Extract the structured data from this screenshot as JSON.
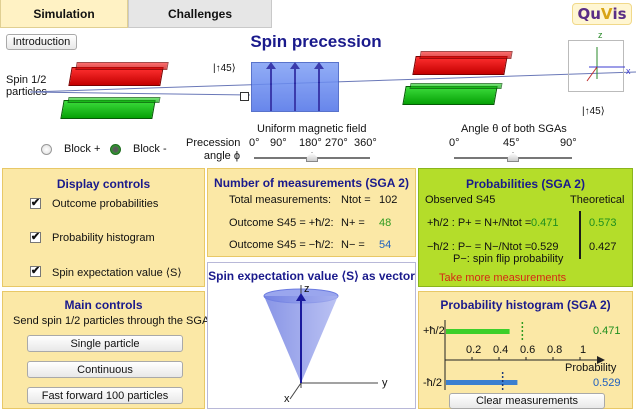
{
  "tabs": {
    "simulation": "Simulation",
    "challenges": "Challenges"
  },
  "logo": {
    "q": "Qu",
    "v": "V",
    "is": "is"
  },
  "intro_button": "Introduction",
  "title": "Spin precession",
  "particles_label_1": "Spin 1/2",
  "particles_label_2": "particles",
  "sga_left_angle": "|↑45⟩",
  "sga_right_angle": "|↑45⟩",
  "axis_labels": {
    "z": "z",
    "x": "x"
  },
  "legend": {
    "block_plus": "Block +",
    "block_minus": "Block -"
  },
  "precession": {
    "label_1": "Precession",
    "label_2": "angle ϕ"
  },
  "field_slider": {
    "title": "Uniform magnetic field",
    "ticks": [
      "0°",
      "90°",
      "180°",
      "270°",
      "360°"
    ],
    "value_deg": 180
  },
  "angle_slider": {
    "title": "Angle θ of both SGAs",
    "ticks": [
      "0°",
      "45°",
      "90°"
    ],
    "value_deg": 45
  },
  "display_controls": {
    "title": "Display controls",
    "items": [
      {
        "label": "Outcome probabilities",
        "checked": true
      },
      {
        "label": "Probability histogram",
        "checked": true
      },
      {
        "label": "Spin expectation value ⟨S⟩",
        "checked": true
      }
    ]
  },
  "main_controls": {
    "title": "Main controls",
    "subtitle": "Send spin 1/2 particles through the SGA",
    "single": "Single particle",
    "continuous": "Continuous",
    "fast": "Fast forward 100 particles"
  },
  "measurements": {
    "title": "Number of measurements (SGA 2)",
    "total_label": "Total measurements:",
    "total_sym": "Ntot =",
    "total_val": "102",
    "plus_label": "Outcome S45 = +ħ/2:",
    "plus_sym": "N+ =",
    "plus_val": "48",
    "minus_label": "Outcome S45 = −ħ/2:",
    "minus_sym": "N− =",
    "minus_val": "54"
  },
  "vector_panel": {
    "title": "Spin expectation value ⟨S⟩ as vector",
    "z": "z",
    "y": "y",
    "x": "x"
  },
  "probabilities": {
    "title": "Probabilities (SGA 2)",
    "observed": "Observed S45",
    "theoretical": "Theoretical",
    "plus_label": "+ħ/2 : P+ = N+/Ntot =",
    "plus_obs": "0.471",
    "plus_th": "0.573",
    "minus_label": "−ħ/2 : P− = N−/Ntot =",
    "minus_obs": "0.529",
    "minus_th": "0.427",
    "flip_note": "P−: spin flip probability",
    "more_link": "Take more measurements"
  },
  "histogram": {
    "title": "Probability histogram (SGA 2)",
    "plus_label": "+ħ/2",
    "minus_label": "-ħ/2",
    "ticks": [
      "0.2",
      "0.4",
      "0.6",
      "0.8",
      "1"
    ],
    "xlabel": "Probability",
    "plus_observed": 0.471,
    "plus_theory": 0.573,
    "minus_observed": 0.529,
    "minus_theory": 0.427,
    "plus_value_text": "0.471",
    "minus_value_text": "0.529",
    "clear_button": "Clear measurements",
    "colors": {
      "plus": "#3ccf2a",
      "minus": "#3a7fd0"
    }
  }
}
